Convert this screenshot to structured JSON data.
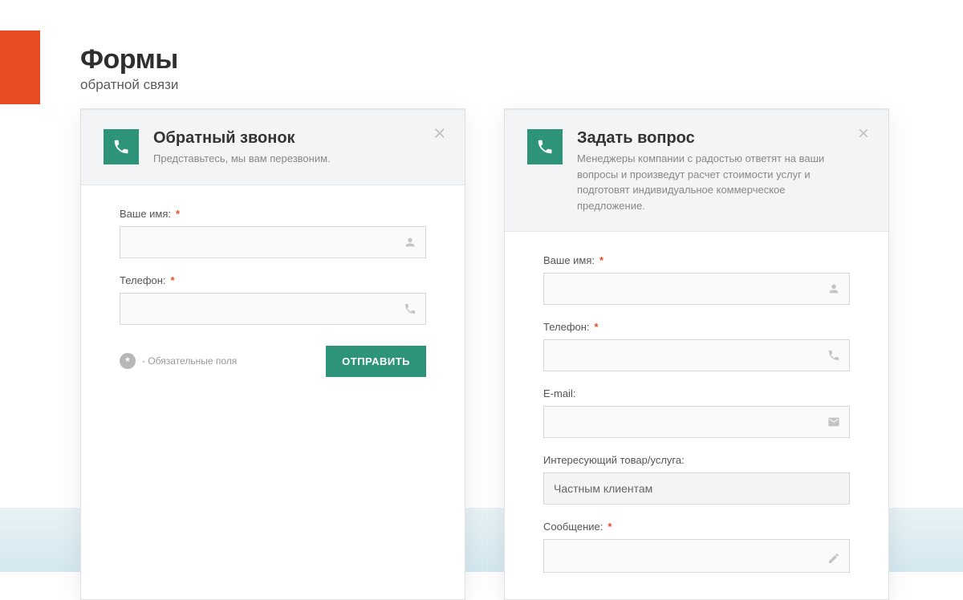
{
  "header": {
    "title": "Формы",
    "subtitle": "обратной связи"
  },
  "callback": {
    "title": "Обратный звонок",
    "subtitle": "Представьтесь, мы вам перезвоним.",
    "name_label": "Ваше имя:",
    "phone_label": "Телефон:",
    "required_note": "- Обязательные поля",
    "submit": "ОТПРАВИТЬ"
  },
  "question": {
    "title": "Задать вопрос",
    "subtitle": "Менеджеры компании с радостью ответят на ваши вопросы и произведут расчет стоимости услуг и подготовят индивидуальное коммерческое предложение.",
    "name_label": "Ваше имя:",
    "phone_label": "Телефон:",
    "email_label": "E-mail:",
    "interest_label": "Интересующий товар/услуга:",
    "interest_value": "Частным клиентам",
    "message_label": "Сообщение:"
  },
  "required_mark": "*"
}
